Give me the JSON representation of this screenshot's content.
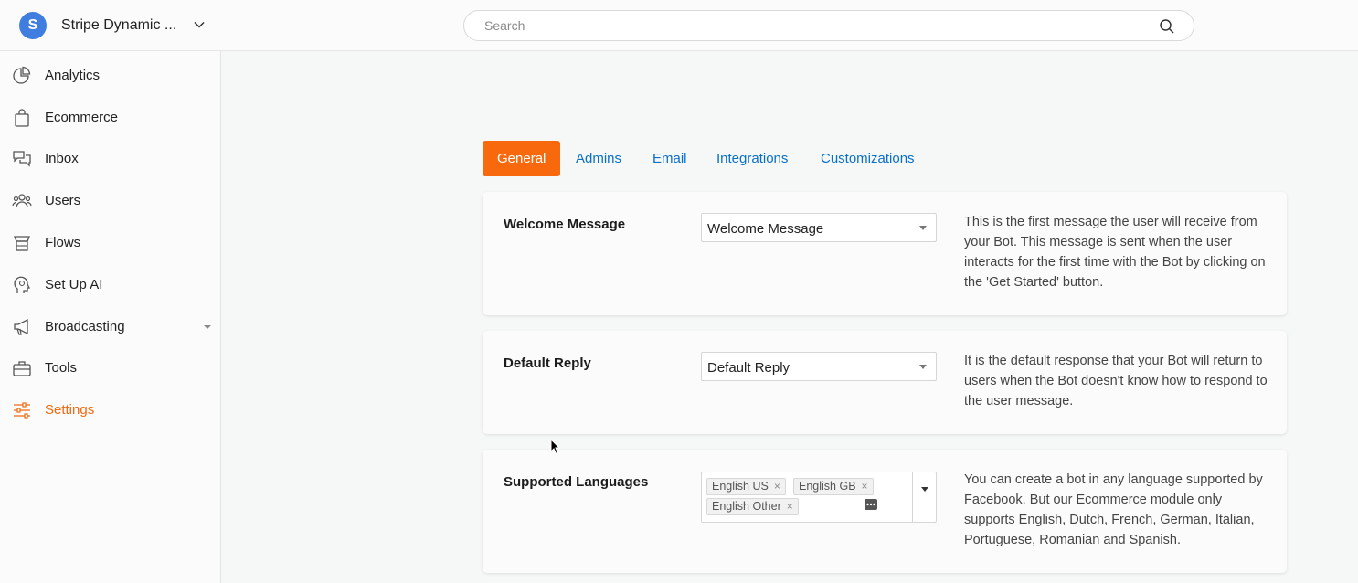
{
  "header": {
    "avatar_letter": "S",
    "workspace_name": "Stripe Dynamic ...",
    "search_placeholder": "Search"
  },
  "sidebar": {
    "items": [
      {
        "label": "Analytics",
        "icon": "pie-chart-icon"
      },
      {
        "label": "Ecommerce",
        "icon": "shopping-bag-icon"
      },
      {
        "label": "Inbox",
        "icon": "chat-bubbles-icon"
      },
      {
        "label": "Users",
        "icon": "users-icon"
      },
      {
        "label": "Flows",
        "icon": "flows-icon"
      },
      {
        "label": "Set Up AI",
        "icon": "ai-head-icon"
      },
      {
        "label": "Broadcasting",
        "icon": "megaphone-icon"
      },
      {
        "label": "Tools",
        "icon": "toolbox-icon"
      },
      {
        "label": "Settings",
        "icon": "sliders-icon",
        "active": true
      }
    ]
  },
  "tabs": [
    {
      "label": "General",
      "active": true
    },
    {
      "label": "Admins"
    },
    {
      "label": "Email"
    },
    {
      "label": "Integrations"
    },
    {
      "label": "Customizations"
    }
  ],
  "cards": {
    "welcome": {
      "title": "Welcome Message",
      "select_value": "Welcome Message",
      "description": "This is the first message the user will receive from your Bot. This message is sent when the user interacts for the first time with the Bot by clicking on the 'Get Started' button."
    },
    "default_reply": {
      "title": "Default Reply",
      "select_value": "Default Reply",
      "description": "It is the default response that your Bot will return to users when the Bot doesn't know how to respond to the user message."
    },
    "languages": {
      "title": "Supported Languages",
      "chips": [
        "English US",
        "English GB",
        "English Other"
      ],
      "chip_remove": "×",
      "description": "You can create a bot in any language supported by Facebook. But our Ecommerce module only supports English, Dutch, French, German, Italian, Portuguese, Romanian and Spanish."
    }
  },
  "colors": {
    "accent": "#f8690e",
    "link": "#0a6fc7",
    "avatar": "#3f7ee0"
  }
}
